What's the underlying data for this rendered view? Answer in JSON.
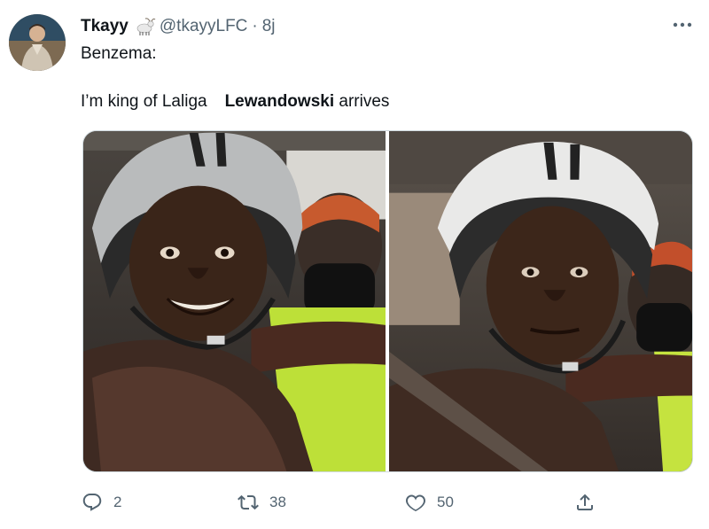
{
  "tweet": {
    "author": {
      "display_name": "Tkayy",
      "badge_icon": "goat-icon",
      "handle": "@tkayyLFC",
      "separator": "·",
      "timestamp": "8j"
    },
    "more_icon": "more-horizontal-icon",
    "text": {
      "line1": "Benzema:",
      "line2_part1": "I’m king of Laliga",
      "line2_bold": "Lewandowski",
      "line2_part2": "arrives"
    },
    "media": {
      "panels": [
        "left-meme-photo",
        "right-meme-photo"
      ]
    },
    "actions": {
      "reply": {
        "icon": "reply-icon",
        "count": "2"
      },
      "retweet": {
        "icon": "retweet-icon",
        "count": "38"
      },
      "like": {
        "icon": "heart-icon",
        "count": "50"
      },
      "share": {
        "icon": "share-icon"
      }
    },
    "colors": {
      "text_primary": "#0f1419",
      "text_secondary": "#536471",
      "border": "#cfd9de"
    }
  }
}
